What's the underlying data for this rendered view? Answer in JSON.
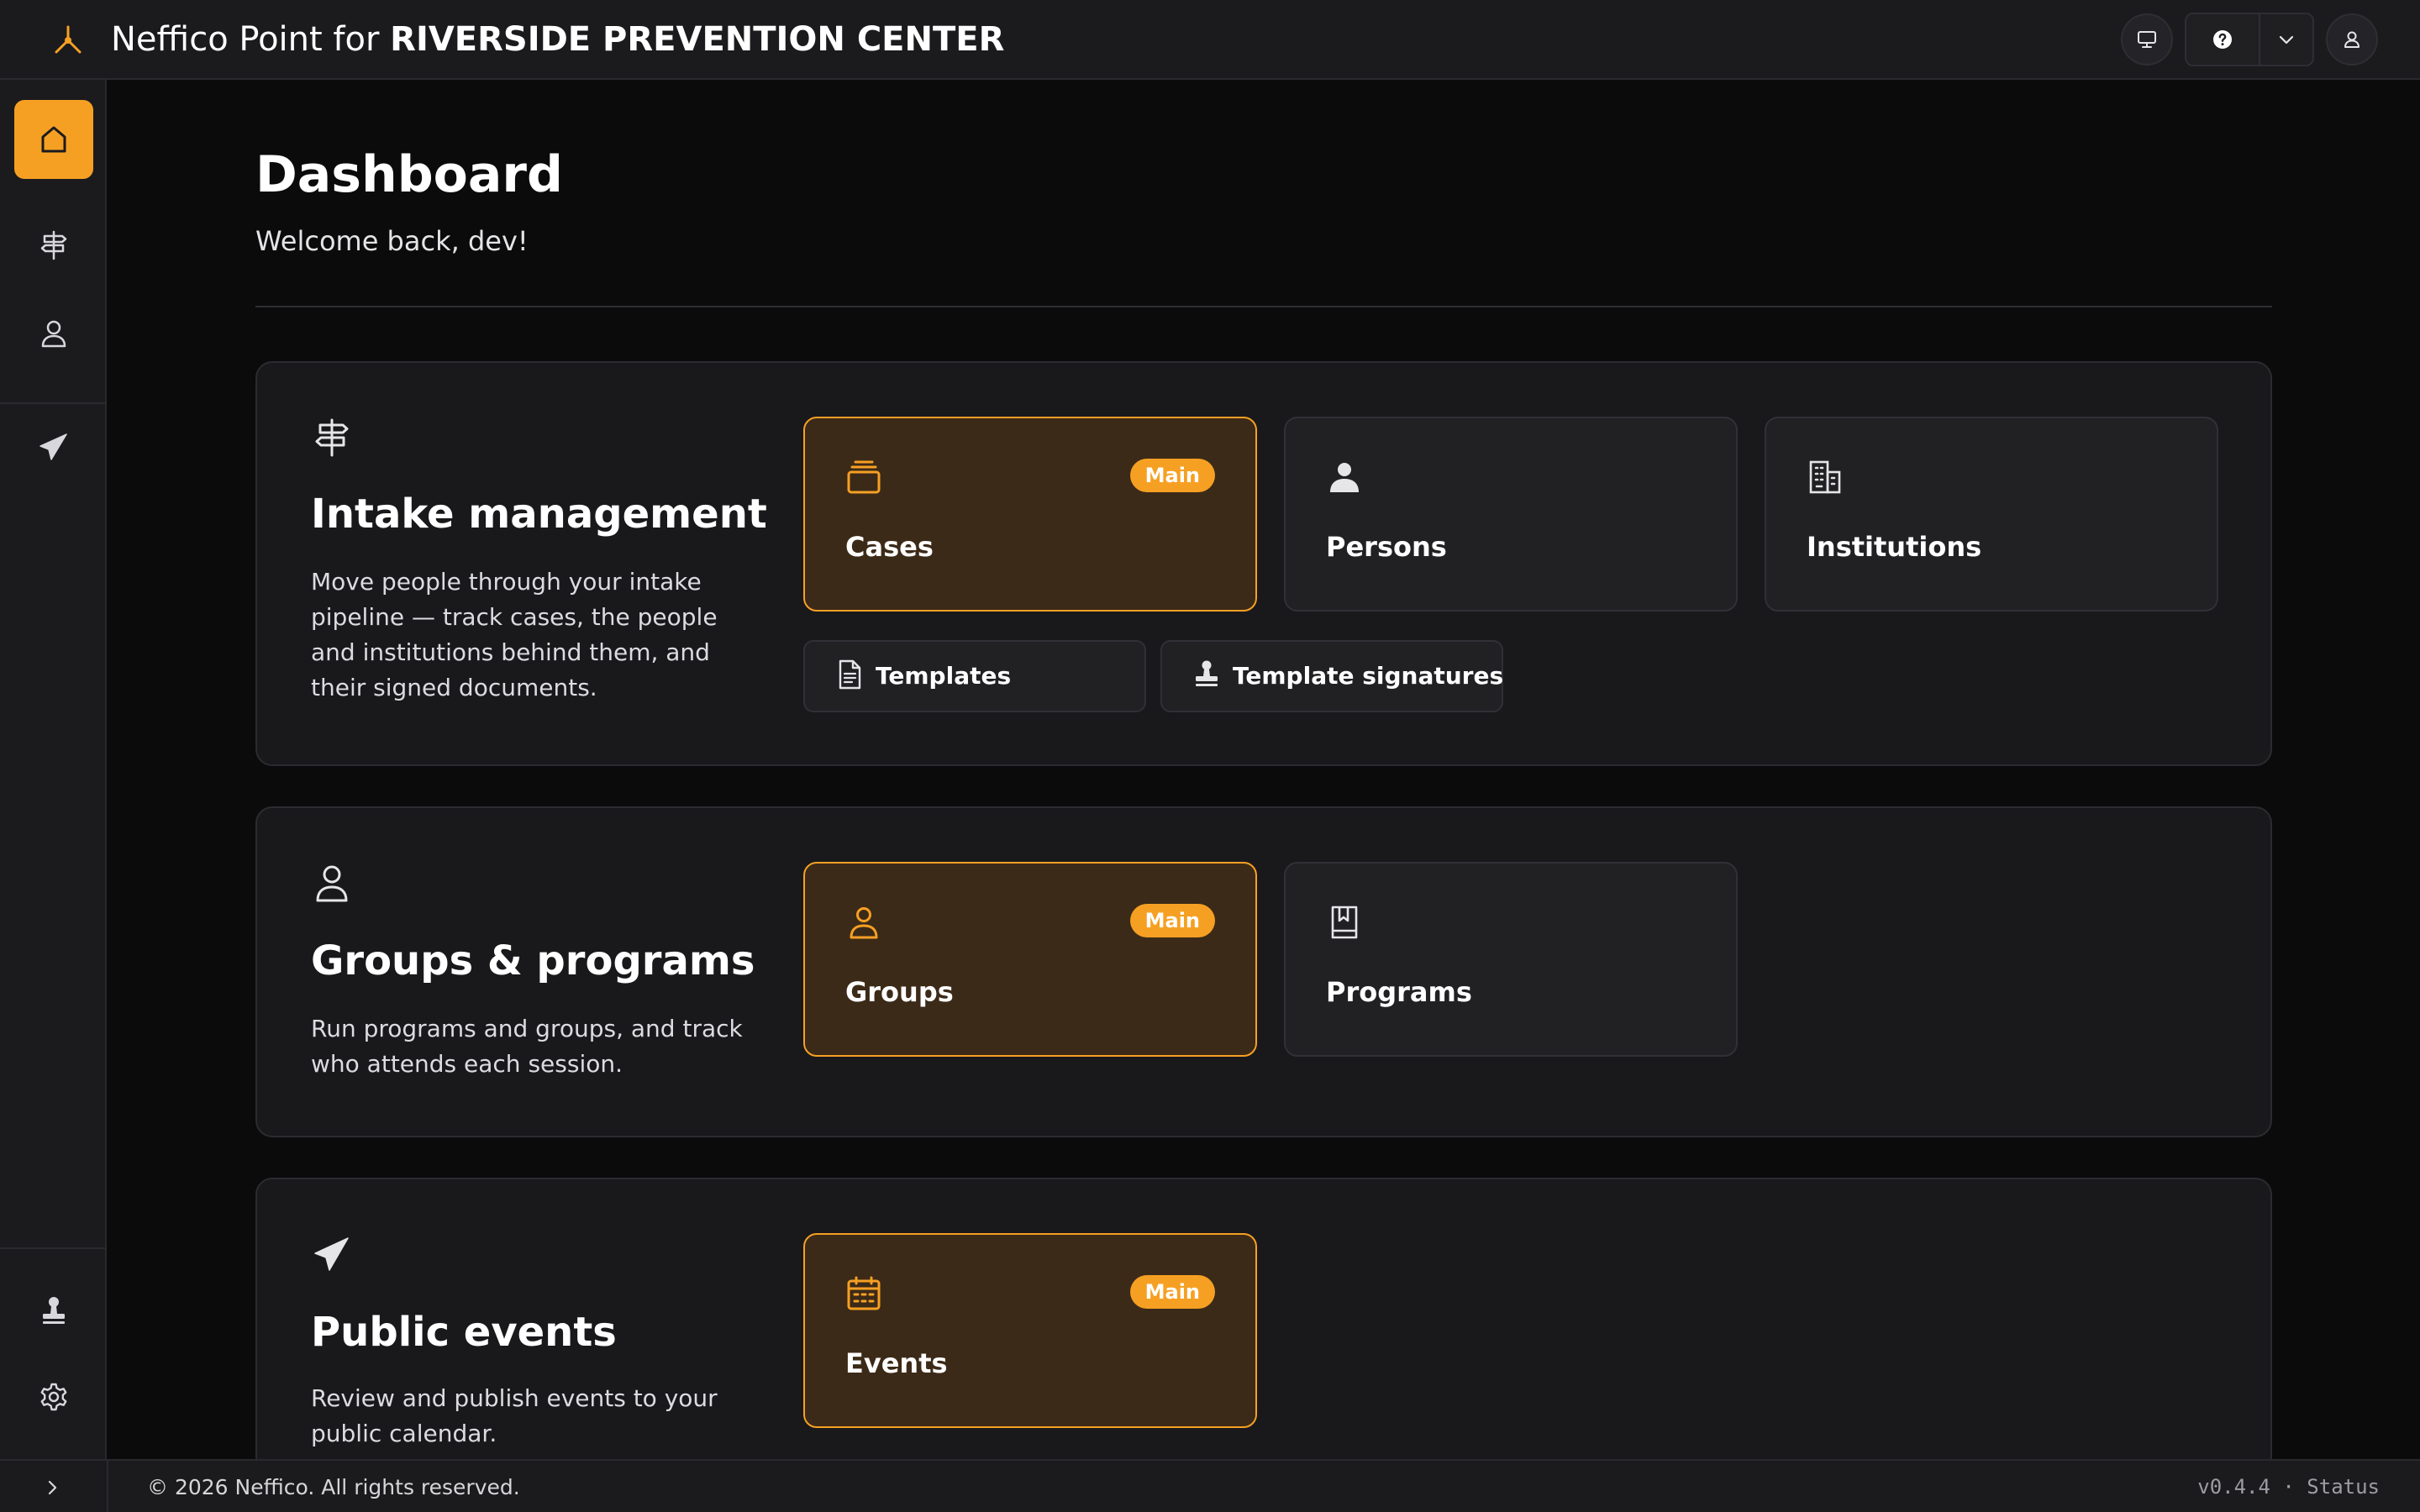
{
  "header": {
    "app_name_prefix": "Neffico Point for ",
    "organization": "RIVERSIDE PREVENTION CENTER",
    "logo_icon": "tripod-logo-icon",
    "accent_color": "#f6a023",
    "actions": {
      "display_icon": "monitor-icon",
      "help_icon": "help-circle-icon",
      "dropdown_icon": "chevron-down-icon",
      "user_icon": "user-icon"
    }
  },
  "sidebar": {
    "items": [
      {
        "icon": "home-icon",
        "active": true
      },
      {
        "icon": "signpost-icon",
        "active": false
      },
      {
        "icon": "user-icon",
        "active": false
      },
      {
        "icon": "send-icon",
        "active": false
      }
    ],
    "bottom_items": [
      {
        "icon": "stamp-icon"
      },
      {
        "icon": "gear-icon"
      }
    ]
  },
  "page": {
    "title": "Dashboard",
    "welcome": "Welcome back, dev!"
  },
  "sections": [
    {
      "icon": "signpost-icon",
      "title": "Intake management",
      "description": "Move people through your intake pipeline — track cases, the people and institutions behind them, and their signed documents.",
      "cards": [
        {
          "label": "Cases",
          "icon": "layers-icon",
          "badge": "Main"
        },
        {
          "label": "Persons",
          "icon": "person-icon"
        },
        {
          "label": "Institutions",
          "icon": "building-icon"
        }
      ],
      "links": [
        {
          "label": "Templates",
          "icon": "document-icon"
        },
        {
          "label": "Template signatures",
          "icon": "stamp-icon"
        }
      ]
    },
    {
      "icon": "user-icon",
      "title": "Groups & programs",
      "description": "Run programs and groups, and track who attends each session.",
      "cards": [
        {
          "label": "Groups",
          "icon": "user-icon",
          "badge": "Main"
        },
        {
          "label": "Programs",
          "icon": "book-icon"
        }
      ]
    },
    {
      "icon": "send-icon",
      "title": "Public events",
      "description": "Review and publish events to your public calendar.",
      "cards": [
        {
          "label": "Events",
          "icon": "calendar-icon",
          "badge": "Main"
        }
      ]
    }
  ],
  "footer": {
    "copyright": "© 2026 Neffico. All rights reserved.",
    "version": "v0.4.4 · Status",
    "expand_icon": "chevron-right-icon"
  }
}
